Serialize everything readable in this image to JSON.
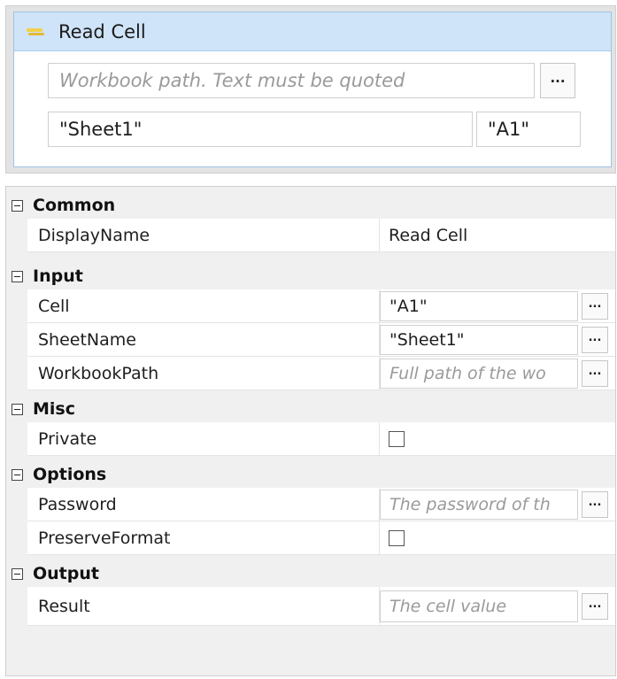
{
  "activity": {
    "icon": "read-cell-icon",
    "title": "Read Cell",
    "workbook_path_placeholder": "Workbook path. Text must be quoted",
    "sheet_value": "\"Sheet1\"",
    "cell_value": "\"A1\"",
    "browse_label": "..."
  },
  "properties": {
    "common": {
      "label": "Common",
      "display_name": {
        "name": "DisplayName",
        "value": "Read Cell"
      }
    },
    "input": {
      "label": "Input",
      "cell": {
        "name": "Cell",
        "value": "\"A1\""
      },
      "sheet_name": {
        "name": "SheetName",
        "value": "\"Sheet1\""
      },
      "workbook_path": {
        "name": "WorkbookPath",
        "placeholder": "Full path of the wo"
      }
    },
    "misc": {
      "label": "Misc",
      "private": {
        "name": "Private",
        "checked": false
      }
    },
    "options": {
      "label": "Options",
      "password": {
        "name": "Password",
        "placeholder": "The password of th"
      },
      "preserve_format": {
        "name": "PreserveFormat",
        "checked": false
      }
    },
    "output": {
      "label": "Output",
      "result": {
        "name": "Result",
        "placeholder": "The cell value"
      }
    },
    "browse_label": "..."
  }
}
